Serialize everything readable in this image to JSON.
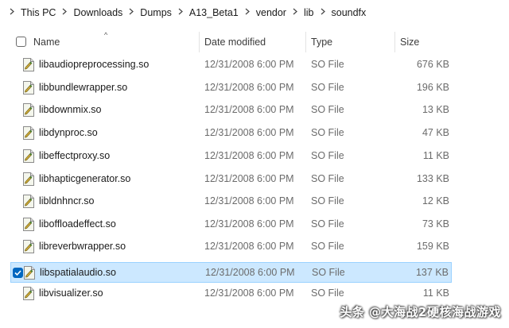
{
  "breadcrumb": {
    "items": [
      "This PC",
      "Downloads",
      "Dumps",
      "A13_Beta1",
      "vendor",
      "lib",
      "soundfx"
    ],
    "separator_icon": "chevron-right-icon"
  },
  "header": {
    "sort_indicator": "^",
    "columns": {
      "name": "Name",
      "date": "Date modified",
      "type": "Type",
      "size": "Size"
    }
  },
  "files": [
    {
      "name": "libaudiopreprocessing.so",
      "date": "12/31/2008 6:00 PM",
      "type": "SO File",
      "size": "676 KB",
      "selected": false
    },
    {
      "name": "libbundlewrapper.so",
      "date": "12/31/2008 6:00 PM",
      "type": "SO File",
      "size": "196 KB",
      "selected": false
    },
    {
      "name": "libdownmix.so",
      "date": "12/31/2008 6:00 PM",
      "type": "SO File",
      "size": "13 KB",
      "selected": false
    },
    {
      "name": "libdynproc.so",
      "date": "12/31/2008 6:00 PM",
      "type": "SO File",
      "size": "47 KB",
      "selected": false
    },
    {
      "name": "libeffectproxy.so",
      "date": "12/31/2008 6:00 PM",
      "type": "SO File",
      "size": "11 KB",
      "selected": false
    },
    {
      "name": "libhapticgenerator.so",
      "date": "12/31/2008 6:00 PM",
      "type": "SO File",
      "size": "133 KB",
      "selected": false
    },
    {
      "name": "libldnhncr.so",
      "date": "12/31/2008 6:00 PM",
      "type": "SO File",
      "size": "12 KB",
      "selected": false
    },
    {
      "name": "liboffloadeffect.so",
      "date": "12/31/2008 6:00 PM",
      "type": "SO File",
      "size": "73 KB",
      "selected": false
    },
    {
      "name": "libreverbwrapper.so",
      "date": "12/31/2008 6:00 PM",
      "type": "SO File",
      "size": "159 KB",
      "selected": false
    },
    {
      "name": "libspatialaudio.so",
      "date": "12/31/2008 6:00 PM",
      "type": "SO File",
      "size": "137 KB",
      "selected": true
    },
    {
      "name": "libvisualizer.so",
      "date": "12/31/2008 6:00 PM",
      "type": "SO File",
      "size": "11 KB",
      "selected": false
    }
  ],
  "file_icon": "so-file-icon",
  "colors": {
    "selection_bg": "#cce8ff",
    "selection_border": "#99d1ff",
    "checkbox_accent": "#0067c0",
    "secondary_text": "#6b6b6b"
  },
  "watermark": "头条 @大海战2硬核海战游戏"
}
